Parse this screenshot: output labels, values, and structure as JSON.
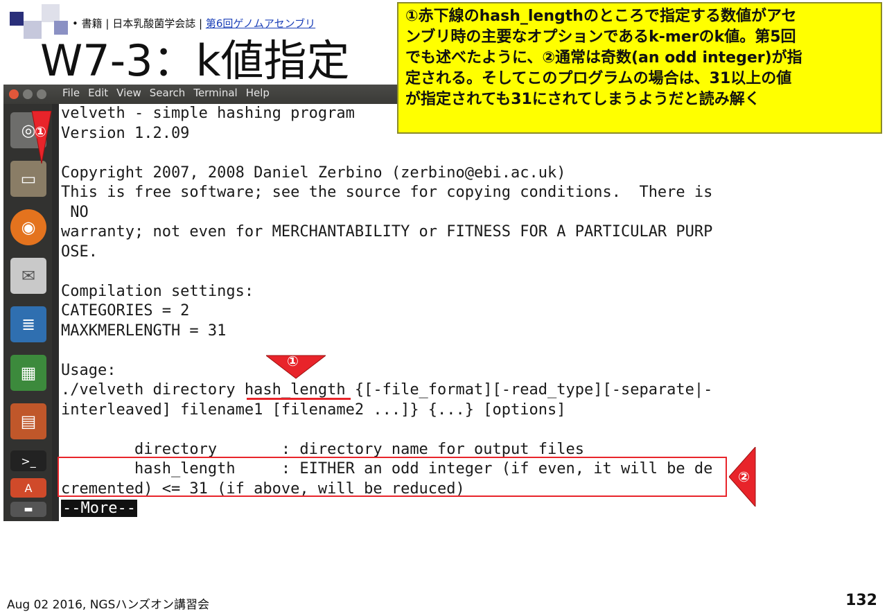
{
  "slide": {
    "breadcrumb_prefix": "• 書籍 | 日本乳酸菌学会誌 |",
    "breadcrumb_link": "第6回ゲノムアセンブリ",
    "title": "W7-3：k値指定",
    "footer": "Aug 02 2016, NGSハンズオン講習会",
    "page_number": "132"
  },
  "callout": {
    "lines": [
      "①赤下線のhash_lengthのところで指定する数値がアセ",
      "ンブリ時の主要なオプションであるk-merのk値。第5回",
      "でも述べたように、②通常は奇数(an odd integer)が指",
      "定される。そしてこのプログラムの場合は、31以上の値",
      "が指定されても31にされてしまうようだと読み解く"
    ]
  },
  "menu": [
    "File",
    "Edit",
    "View",
    "Search",
    "Terminal",
    "Help"
  ],
  "launcher": {
    "icons": [
      "dash-icon",
      "files-icon",
      "firefox-icon",
      "mail-icon",
      "writer-icon",
      "calc-icon",
      "impress-icon",
      "terminal-icon",
      "text-editor-icon",
      "workspace-icon"
    ]
  },
  "terminal": {
    "lines": [
      "velveth - simple hashing program",
      "Version 1.2.09",
      "",
      "Copyright 2007, 2008 Daniel Zerbino (zerbino@ebi.ac.uk)",
      "This is free software; see the source for copying conditions.  There is",
      " NO",
      "warranty; not even for MERCHANTABILITY or FITNESS FOR A PARTICULAR PURP",
      "OSE.",
      "",
      "Compilation settings:",
      "CATEGORIES = 2",
      "MAXKMERLENGTH = 31",
      "",
      "Usage:",
      "./velveth directory hash_length {[-file_format][-read_type][-separate|-",
      "interleaved] filename1 [filename2 ...]} {...} [options]",
      "",
      "        directory       : directory name for output files",
      "        hash_length     : EITHER an odd integer (if even, it will be de",
      "cremented) <= 31 (if above, will be reduced)"
    ],
    "pager": "--More--"
  },
  "annotations": {
    "badge1": "①",
    "badge2": "②"
  },
  "colors": {
    "callout_bg": "#ffff00",
    "annotation_red": "#e8242a",
    "terminal_bg": "#ffffff"
  }
}
